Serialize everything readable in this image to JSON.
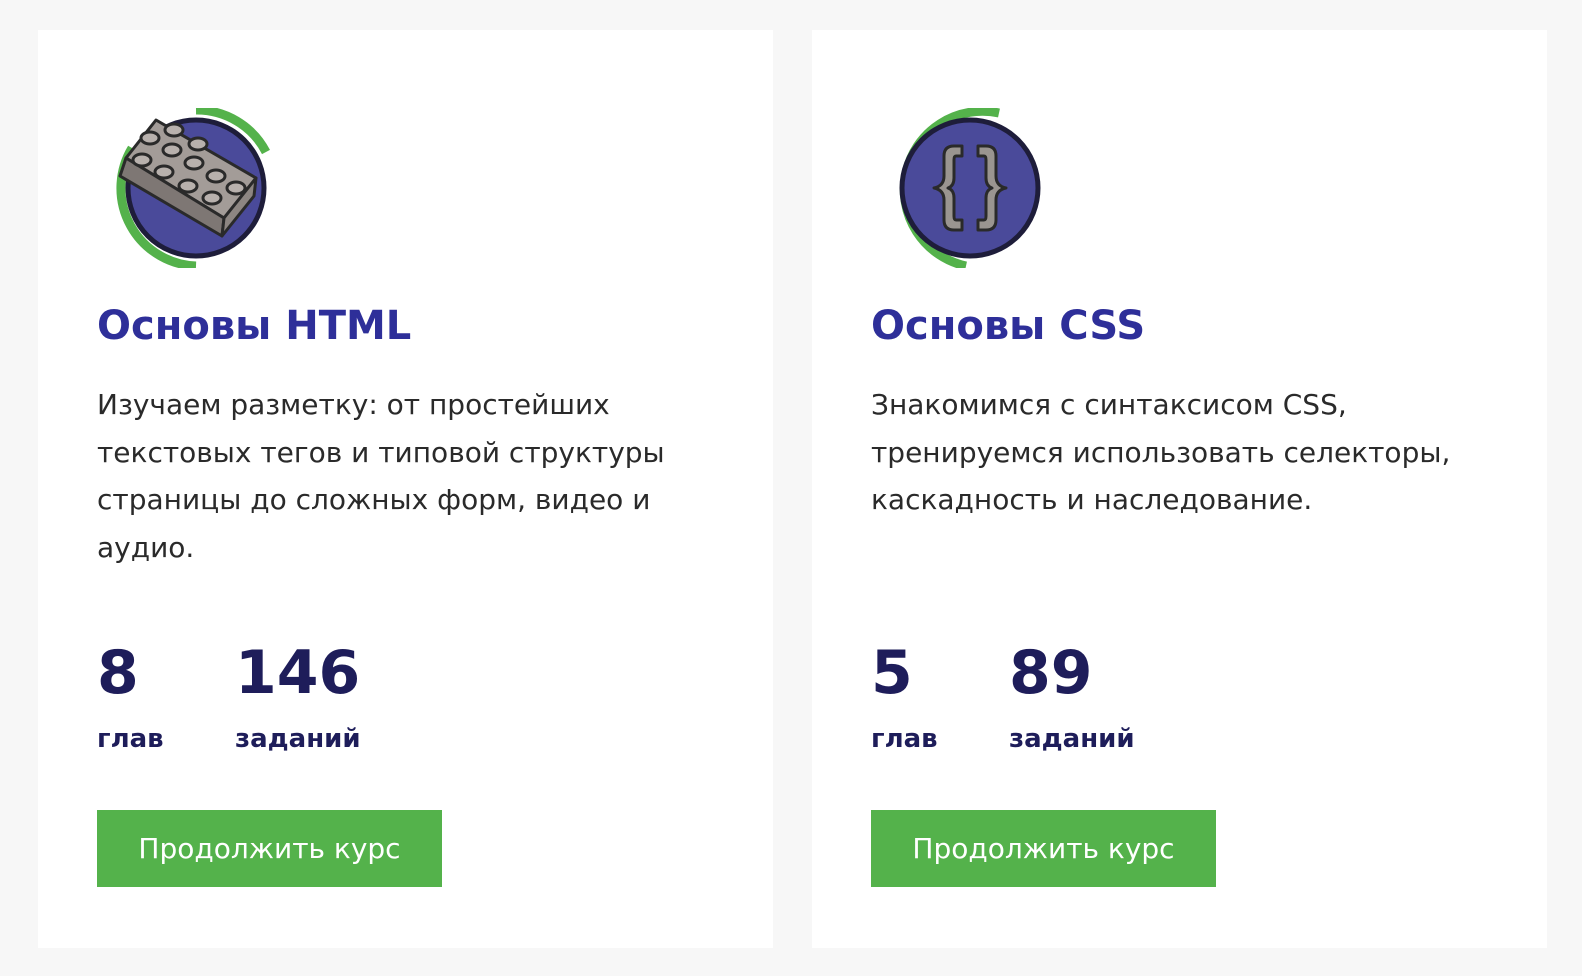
{
  "colors": {
    "page_background": "#f7f7f7",
    "card_background": "#ffffff",
    "title": "#2e2f99",
    "stat_text": "#1e1d5a",
    "button": "#54b24b",
    "progress_ring": "#54b24b",
    "icon_circle": "#4a4a9a"
  },
  "courses": [
    {
      "icon": "lego-brick-icon",
      "progress_ring_fraction": 0.62,
      "title": "Основы HTML",
      "description": "Изучаем разметку: от простейших текстовых тегов и типовой структуры страницы до сложных форм, видео и аудио.",
      "chapters_count": "8",
      "chapters_label": "глав",
      "tasks_count": "146",
      "tasks_label": "заданий",
      "button_label": "Продолжить курс"
    },
    {
      "icon": "curly-braces-icon",
      "progress_ring_fraction": 0.6,
      "title": "Основы CSS",
      "description": "Знакомимся с синтаксисом CSS, тренируемся использовать селекторы, каскадность и наследование.",
      "chapters_count": "5",
      "chapters_label": "глав",
      "tasks_count": "89",
      "tasks_label": "заданий",
      "button_label": "Продолжить курс"
    }
  ]
}
